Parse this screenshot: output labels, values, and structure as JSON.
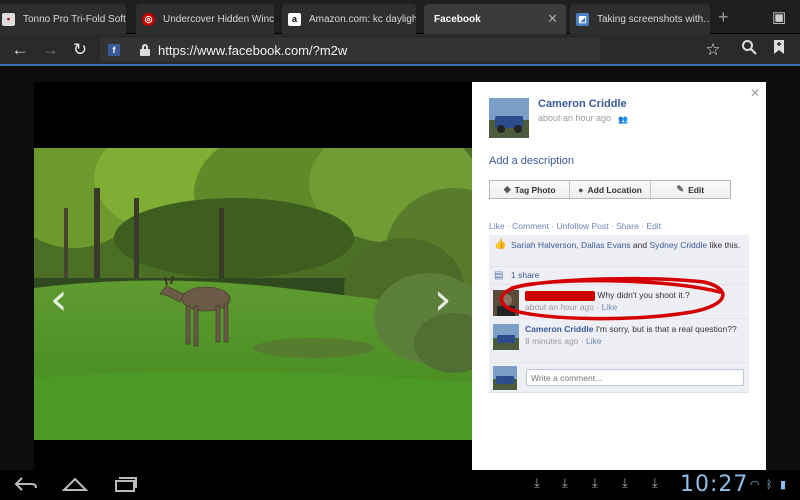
{
  "browser": {
    "tabs": [
      {
        "title": "Tonno Pro Tri-Fold Soft…",
        "favicon": "generic-page-icon"
      },
      {
        "title": "Undercover Hidden Winc…",
        "favicon": "toyota-logo-icon"
      },
      {
        "title": "Amazon.com: kc daylight…",
        "favicon": "amazon-logo-icon",
        "favicon_text": "a"
      },
      {
        "title": "Facebook",
        "favicon": "none"
      },
      {
        "title": "Taking screenshots with…",
        "favicon": "page-icon"
      }
    ],
    "active_tab_index": 3,
    "url": "https://www.facebook.com/?m2w",
    "url_favicon_text": "f"
  },
  "photo_viewer": {
    "prev_arrow": "‹",
    "next_arrow": "›"
  },
  "post": {
    "author": "Cameron Criddle",
    "time": "about an hour ago",
    "add_description": "Add a description",
    "buttons": [
      {
        "label": "Tag Photo",
        "icon": "tag-icon"
      },
      {
        "label": "Add Location",
        "icon": "location-pin-icon"
      },
      {
        "label": "Edit",
        "icon": "pencil-icon"
      }
    ],
    "actions": [
      "Like",
      "Comment",
      "Unfollow Post",
      "Share",
      "Edit"
    ],
    "likes": {
      "names": [
        "Sariah Halverson",
        "Dallas Evans",
        "Sydney Criddle"
      ],
      "and_word": "and",
      "suffix": "like this."
    },
    "shares": "1 share",
    "comments": [
      {
        "author": "",
        "text": "Why didn't you shoot it.?",
        "time": "about an hour ago",
        "like_label": "Like",
        "redacted": true
      },
      {
        "author": "Cameron Criddle",
        "text": "I'm sorry, but is that a real question??",
        "time": "8 minutes ago",
        "like_label": "Like",
        "redacted": false
      }
    ],
    "comment_placeholder": "Write a comment..."
  },
  "system_bar": {
    "clock": "10:27"
  },
  "colors": {
    "facebook_blue": "#3b5998",
    "link_blue": "#6d84b4",
    "annotation_red": "#d40000",
    "clock_blue": "#8fbfe8"
  }
}
